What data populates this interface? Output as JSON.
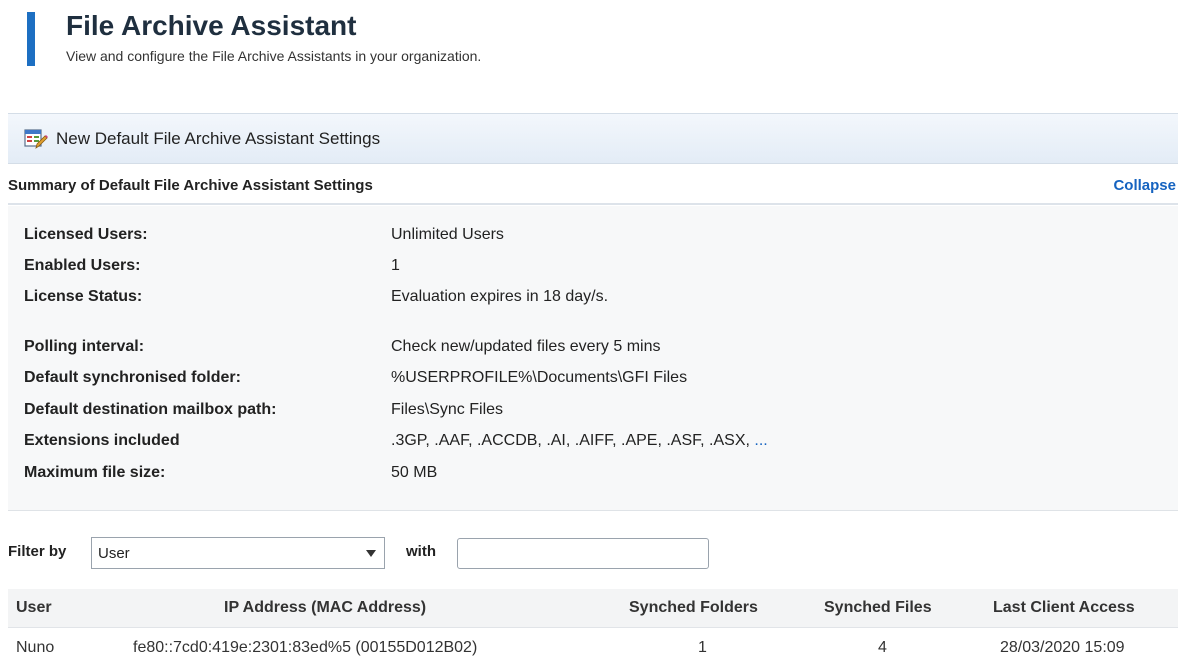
{
  "header": {
    "title": "File Archive Assistant",
    "subtitle": "View and configure the File Archive Assistants in your organization."
  },
  "toolbar": {
    "new_settings_label": "New Default File Archive Assistant Settings",
    "new_settings_icon": "settings-edit-icon"
  },
  "summary": {
    "title": "Summary of Default File Archive Assistant Settings",
    "collapse_label": "Collapse",
    "rows": [
      {
        "label": "Licensed Users:",
        "value": "Unlimited Users"
      },
      {
        "label": "Enabled Users:",
        "value": "1"
      },
      {
        "label": "License Status:",
        "value": "Evaluation expires in 18 day/s."
      },
      {
        "label": "Polling interval:",
        "value": "Check new/updated files every 5 mins"
      },
      {
        "label": "Default synchronised folder:",
        "value": "%USERPROFILE%\\Documents\\GFI Files"
      },
      {
        "label": "Default destination mailbox path:",
        "value": "Files\\Sync Files"
      },
      {
        "label": "Extensions included",
        "value": ".3GP, .AAF, .ACCDB, .AI, .AIFF, .APE, .ASF, .ASX, ",
        "more": "..."
      },
      {
        "label": "Maximum file size:",
        "value": "50 MB"
      }
    ]
  },
  "filter": {
    "label": "Filter by",
    "selected": "User",
    "with_label": "with",
    "with_value": ""
  },
  "table": {
    "columns": [
      "User",
      "IP Address (MAC Address)",
      "Synched Folders",
      "Synched Files",
      "Last Client Access"
    ],
    "rows": [
      [
        "Nuno",
        "fe80::7cd0:419e:2301:83ed%5 (00155D012B02)",
        "1",
        "4",
        "28/03/2020 15:09"
      ]
    ]
  },
  "colors": {
    "accent": "#1d6fc2",
    "link": "#1563c0",
    "toolbar_bg": "#e3ecf6",
    "summary_bg": "#f7f8f9"
  }
}
